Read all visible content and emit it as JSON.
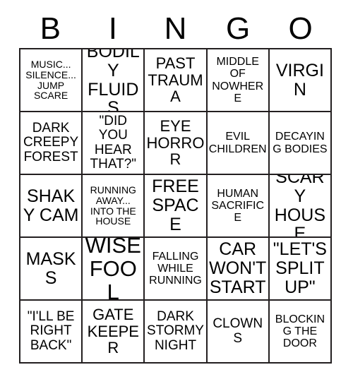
{
  "card": {
    "title_letters": [
      "B",
      "I",
      "N",
      "G",
      "O"
    ],
    "grid": {
      "rows": 5,
      "columns": 5,
      "border_color": "#231f20",
      "background_color": "#ffffff",
      "text_color": "#000000"
    },
    "cells": [
      {
        "text": "MUSIC... SILENCE... JUMP SCARE",
        "size": "xs",
        "column": "B",
        "row": 1
      },
      {
        "text": "BODILY FLUIDS",
        "size": "xl",
        "column": "I",
        "row": 1
      },
      {
        "text": "PAST TRAUMA",
        "size": "l",
        "column": "N",
        "row": 1
      },
      {
        "text": "MIDDLE OF NOWHERE",
        "size": "s",
        "column": "G",
        "row": 1
      },
      {
        "text": "VIRGIN",
        "size": "xl",
        "column": "O",
        "row": 1
      },
      {
        "text": "DARK CREEPY FOREST",
        "size": "m",
        "column": "B",
        "row": 2
      },
      {
        "text": "\"DID YOU HEAR THAT?\"",
        "size": "m",
        "column": "I",
        "row": 2
      },
      {
        "text": "EYE HORROR",
        "size": "l",
        "column": "N",
        "row": 2
      },
      {
        "text": "EVIL CHILDREN",
        "size": "s",
        "column": "G",
        "row": 2
      },
      {
        "text": "DECAYING BODIES",
        "size": "s",
        "column": "O",
        "row": 2
      },
      {
        "text": "SHAKY CAM",
        "size": "xl",
        "column": "B",
        "row": 3
      },
      {
        "text": "RUNNING AWAY... INTO THE HOUSE",
        "size": "xs",
        "column": "I",
        "row": 3
      },
      {
        "text": "FREE SPACE",
        "size": "xl",
        "column": "N",
        "row": 3
      },
      {
        "text": "HUMAN SACRIFICE",
        "size": "s",
        "column": "G",
        "row": 3
      },
      {
        "text": "SCARY HOUSE",
        "size": "xl",
        "column": "O",
        "row": 3
      },
      {
        "text": "MASKS",
        "size": "xl",
        "column": "B",
        "row": 4
      },
      {
        "text": "WISE FOOL",
        "size": "xxl",
        "column": "I",
        "row": 4
      },
      {
        "text": "FALLING WHILE RUNNING",
        "size": "s",
        "column": "N",
        "row": 4
      },
      {
        "text": "CAR WON'T START",
        "size": "xl",
        "column": "G",
        "row": 4
      },
      {
        "text": "\"LET'S SPLIT UP\"",
        "size": "xl",
        "column": "O",
        "row": 4
      },
      {
        "text": "\"I'LL BE RIGHT BACK\"",
        "size": "m",
        "column": "B",
        "row": 5
      },
      {
        "text": "GATE KEEPER",
        "size": "l",
        "column": "I",
        "row": 5
      },
      {
        "text": "DARK STORMY NIGHT",
        "size": "m",
        "column": "N",
        "row": 5
      },
      {
        "text": "CLOWNS",
        "size": "m",
        "column": "G",
        "row": 5
      },
      {
        "text": "BLOCKING THE DOOR",
        "size": "s",
        "column": "O",
        "row": 5
      }
    ]
  }
}
